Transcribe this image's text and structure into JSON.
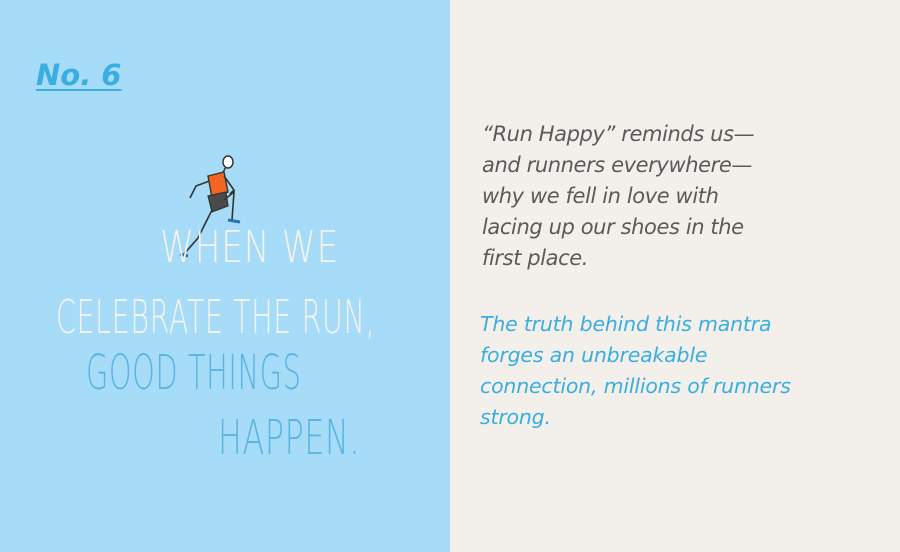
{
  "badge": {
    "number_label": "No. 6"
  },
  "headline": {
    "line1": "WHEN WE",
    "line2": "CELEBRATE THE RUN,",
    "line3": "GOOD THINGS",
    "line4": "HAPPEN."
  },
  "quote": {
    "text": "“Run Happy” reminds us—and runners everywhere—why we fell in love with lacing up our shoes in the first place."
  },
  "body": {
    "text": "The truth behind this mantra forges an unbreakable connection, millions of runners strong."
  },
  "colors": {
    "left_panel_bg": "#a6dcf7",
    "right_panel_bg": "#f3f0eb",
    "accent_blue": "#3aaee0",
    "headline_white": "#f5f3ee",
    "headline_blue": "#5bb5e3",
    "quote_gray": "#5a5a5a",
    "runner_shirt": "#f26522"
  },
  "illustration": {
    "icon": "runner-icon"
  }
}
